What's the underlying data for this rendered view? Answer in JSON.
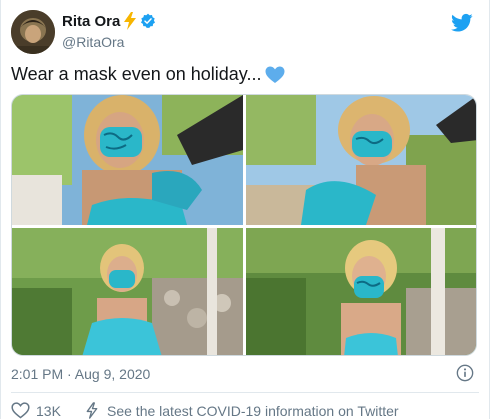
{
  "author": {
    "display_name": "Rita Ora",
    "handle": "@RitaOra",
    "badge_icons": [
      "lightning-bolt-emoji",
      "verified-badge-icon"
    ]
  },
  "tweet": {
    "text": "Wear a mask even on holiday...",
    "emoji": "blue-heart",
    "timestamp": "2:01 PM · Aug 9, 2020"
  },
  "media": {
    "photo_count": 4
  },
  "actions": {
    "like_count": "13K",
    "covid_link_text": "See the latest COVID-19 information on Twitter"
  },
  "colors": {
    "twitter_blue": "#1da1f2",
    "heart_blue": "#5dadec",
    "muted_text": "#657786",
    "mask_teal": "#2ab7c9"
  }
}
